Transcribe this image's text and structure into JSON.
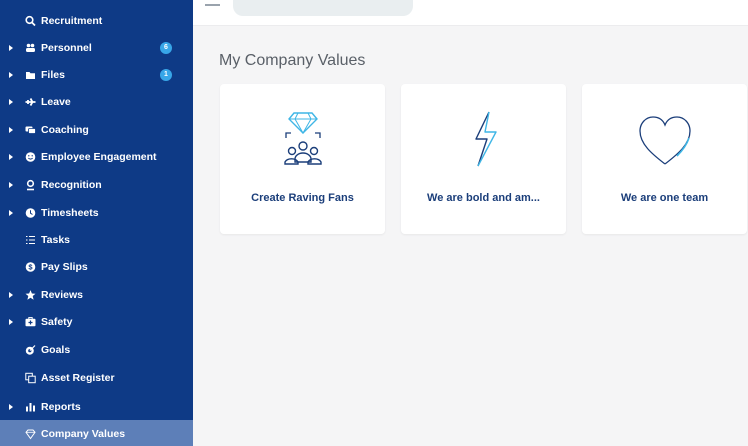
{
  "sidebar": {
    "items": [
      {
        "label": "Recruitment",
        "icon": "search-people-icon",
        "arrow": false,
        "badge": null
      },
      {
        "label": "Personnel",
        "icon": "people-icon",
        "arrow": true,
        "badge": "6"
      },
      {
        "label": "Files",
        "icon": "folder-icon",
        "arrow": true,
        "badge": "1"
      },
      {
        "label": "Leave",
        "icon": "plane-icon",
        "arrow": true,
        "badge": null
      },
      {
        "label": "Coaching",
        "icon": "chat-icon",
        "arrow": true,
        "badge": null
      },
      {
        "label": "Employee Engagement",
        "icon": "smile-icon",
        "arrow": true,
        "badge": null
      },
      {
        "label": "Recognition",
        "icon": "award-icon",
        "arrow": true,
        "badge": null
      },
      {
        "label": "Timesheets",
        "icon": "clock-icon",
        "arrow": true,
        "badge": null
      },
      {
        "label": "Tasks",
        "icon": "list-icon",
        "arrow": false,
        "badge": null
      },
      {
        "label": "Pay Slips",
        "icon": "dollar-icon",
        "arrow": false,
        "badge": null
      },
      {
        "label": "Reviews",
        "icon": "star-icon",
        "arrow": true,
        "badge": null
      },
      {
        "label": "Safety",
        "icon": "first-aid-icon",
        "arrow": true,
        "badge": null
      },
      {
        "label": "Goals",
        "icon": "target-icon",
        "arrow": false,
        "badge": null
      },
      {
        "label": "Asset Register",
        "icon": "copy-icon",
        "arrow": false,
        "badge": null
      },
      {
        "label": "Reports",
        "icon": "bar-chart-icon",
        "arrow": true,
        "badge": null
      },
      {
        "label": "Company Values",
        "icon": "diamond-icon",
        "arrow": false,
        "badge": null,
        "active": true
      }
    ]
  },
  "main": {
    "title": "My Company Values",
    "cards": [
      {
        "label": "Create Raving Fans",
        "icon": "diamond-people-icon"
      },
      {
        "label": "We are bold and am...",
        "icon": "lightning-icon"
      },
      {
        "label": "We are one team",
        "icon": "heart-icon"
      }
    ]
  },
  "colors": {
    "sidebar_bg": "#0e3a86",
    "active_bg": "#5d7fb8",
    "badge": "#38a6e8",
    "card_text": "#1b3e7a",
    "icon_stroke": "#1b3e7a",
    "icon_accent": "#3fb6e6"
  }
}
